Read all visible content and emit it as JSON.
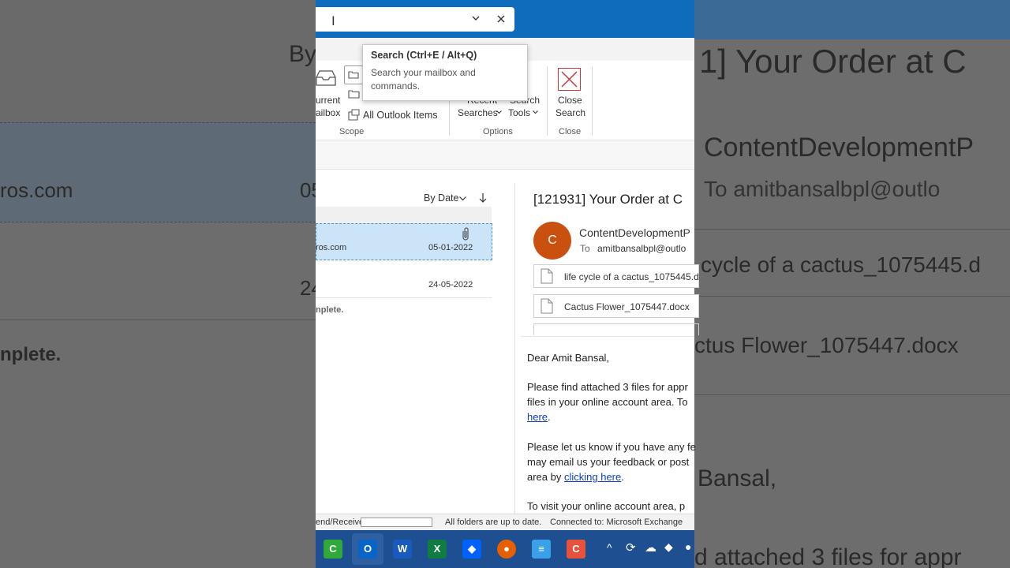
{
  "search": {
    "value": "",
    "tooltip_title": "Search (Ctrl+E / Alt+Q)",
    "tooltip_line1": "Search your mailbox and",
    "tooltip_line2": "commands."
  },
  "ribbon": {
    "scope": {
      "current_mailbox_line1": "urrent",
      "current_mailbox_line2": "ailbox",
      "all_outlook_items": "All Outlook Items",
      "label": "Scope"
    },
    "options": {
      "recent_line1": "Recent",
      "recent_line2": "Searches",
      "tools_line1": "Search",
      "tools_line2": "Tools",
      "label": "Options"
    },
    "close": {
      "line1": "Close",
      "line2": "Search",
      "label": "Close"
    }
  },
  "mail_list": {
    "sort_label": "By Date",
    "items": [
      {
        "sender_fragment": "ros.com",
        "date": "05-01-2022"
      },
      {
        "sender_fragment": "",
        "date": "24-05-2022"
      }
    ],
    "status_fragment": "nplete."
  },
  "reading_pane": {
    "subject": "[121931] Your Order at C",
    "avatar_letter": "C",
    "from": "ContentDevelopmentP",
    "to_label": "To",
    "to_address": "amitbansalbpl@outlo",
    "attachments": [
      "life cycle of a cactus_1075445.d",
      "Cactus Flower_1075447.docx"
    ],
    "greeting": "Dear Amit Bansal,",
    "p1_l1": "Please find attached 3 files for appr",
    "p1_l2": "files in your online account area. To",
    "p1_link": "here",
    "p1_end": ".",
    "p2_l1": "Please let us know if you have any fe",
    "p2_l2": "may email us your feedback or post",
    "p2_l3_pre": "area by ",
    "p2_link": "clicking here",
    "p2_end": ".",
    "p3_l1": "To visit your online account area, p"
  },
  "status_bar": {
    "send_receive": "end/Receive",
    "folders": "All folders are up to date.",
    "connected": "Connected to: Microsoft Exchange"
  },
  "background": {
    "left_by": "By",
    "left_email": "ros.com",
    "left_date1": "05",
    "left_date2": "24",
    "left_complete": "nplete.",
    "right_subject": "1] Your Order at C",
    "right_from": "ContentDevelopmentP",
    "right_to": "To   amitbansalbpl@outlo",
    "right_att1": "cycle of a cactus_1075445.d",
    "right_att2": "ctus Flower_1075447.docx",
    "right_greet": "Bansal,",
    "right_body": "d attached 3 files for appr"
  },
  "colors": {
    "titlebar": "#0f6cbd",
    "selected_row": "#cce4f7",
    "avatar": "#ca5010",
    "link": "#0b3fbf"
  }
}
